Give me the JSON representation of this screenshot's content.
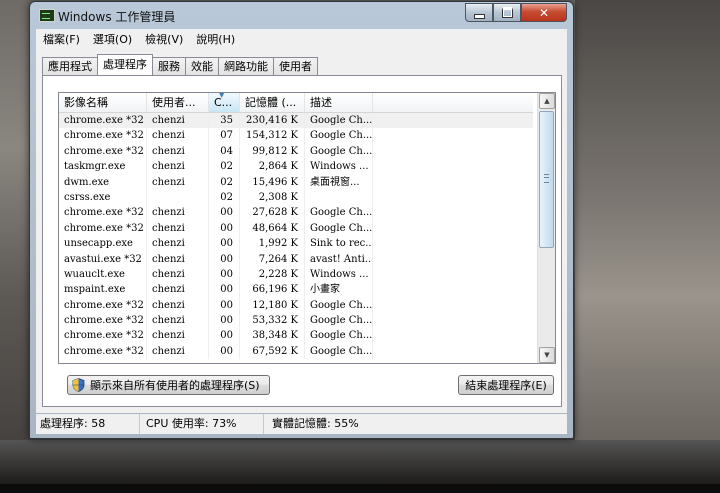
{
  "window": {
    "title": "Windows 工作管理員"
  },
  "menu": [
    "檔案(F)",
    "選項(O)",
    "檢視(V)",
    "說明(H)"
  ],
  "tabs": [
    "應用程式",
    "處理程序",
    "服務",
    "效能",
    "網路功能",
    "使用者"
  ],
  "active_tab": 1,
  "columns": [
    "影像名稱",
    "使用者...",
    "C...",
    "記憶體 (...",
    "描述"
  ],
  "rows": [
    [
      "chrome.exe *32",
      "chenzi",
      "35",
      "230,416 K",
      "Google Ch..."
    ],
    [
      "chrome.exe *32",
      "chenzi",
      "07",
      "154,312 K",
      "Google Ch..."
    ],
    [
      "chrome.exe *32",
      "chenzi",
      "04",
      "99,812 K",
      "Google Ch..."
    ],
    [
      "taskmgr.exe",
      "chenzi",
      "02",
      "2,864 K",
      "Windows ..."
    ],
    [
      "dwm.exe",
      "chenzi",
      "02",
      "15,496 K",
      "桌面視窗..."
    ],
    [
      "csrss.exe",
      "",
      "02",
      "2,308 K",
      ""
    ],
    [
      "chrome.exe *32",
      "chenzi",
      "00",
      "27,628 K",
      "Google Ch..."
    ],
    [
      "chrome.exe *32",
      "chenzi",
      "00",
      "48,664 K",
      "Google Ch..."
    ],
    [
      "unsecapp.exe",
      "chenzi",
      "00",
      "1,992 K",
      "Sink to rec..."
    ],
    [
      "avastui.exe *32",
      "chenzi",
      "00",
      "7,264 K",
      "avast! Anti..."
    ],
    [
      "wuauclt.exe",
      "chenzi",
      "00",
      "2,228 K",
      "Windows ..."
    ],
    [
      "mspaint.exe",
      "chenzi",
      "00",
      "66,196 K",
      "小畫家"
    ],
    [
      "chrome.exe *32",
      "chenzi",
      "00",
      "12,180 K",
      "Google Ch..."
    ],
    [
      "chrome.exe *32",
      "chenzi",
      "00",
      "53,332 K",
      "Google Ch..."
    ],
    [
      "chrome.exe *32",
      "chenzi",
      "00",
      "38,348 K",
      "Google Ch..."
    ],
    [
      "chrome.exe *32",
      "chenzi",
      "00",
      "67,592 K",
      "Google Ch..."
    ]
  ],
  "buttons": {
    "show_all": "顯示來自所有使用者的處理程序(S)",
    "end_process": "結束處理程序(E)"
  },
  "status": {
    "processes": "處理程序: 58",
    "cpu": "CPU 使用率: 73%",
    "memory": "實體記憶體: 55%"
  }
}
